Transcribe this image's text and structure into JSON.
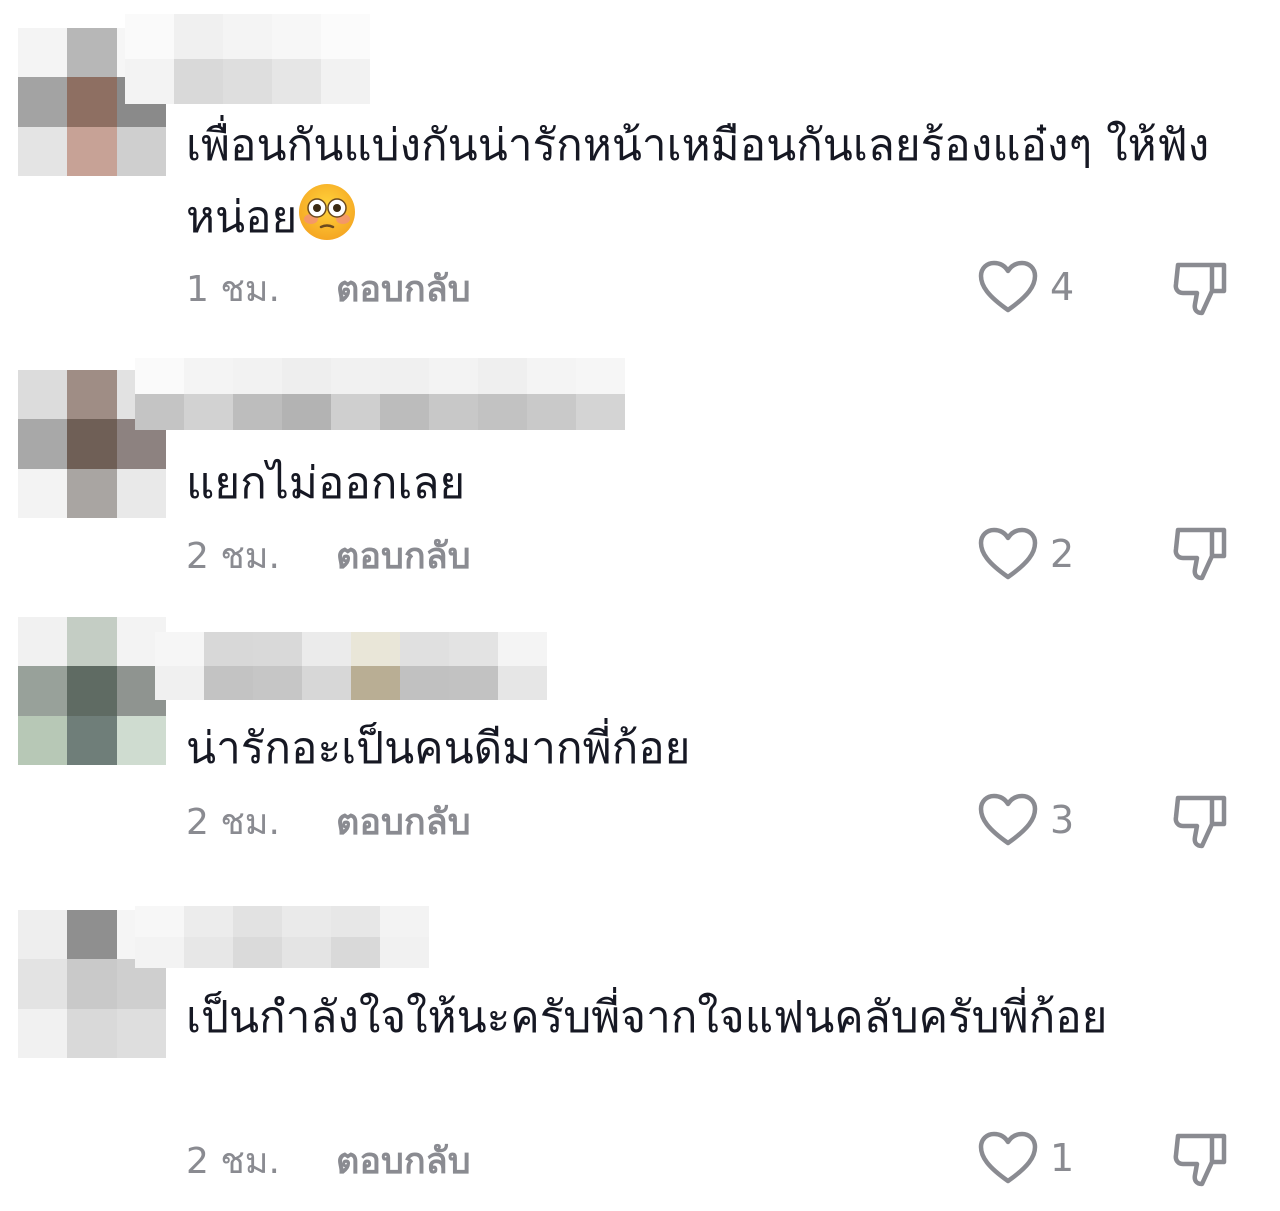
{
  "comments": [
    {
      "text": "เพื่อนกันแบ่งกันน่ารักหน้าเหมือนกันเลยร้องแอ๋งๆ ให้ฟังหน่อย",
      "emoji": "flushed-face",
      "time": "1 ชม.",
      "reply": "ตอบกลับ",
      "likes": "4"
    },
    {
      "text": "แยกไม่ออกเลย",
      "time": "2 ชม.",
      "reply": "ตอบกลับ",
      "likes": "2"
    },
    {
      "text": "น่ารักอะเป็นคนดีมากพี่ก้อย",
      "time": "2 ชม.",
      "reply": "ตอบกลับ",
      "likes": "3"
    },
    {
      "text": "เป็นกำลังใจให้นะครับพี่จากใจแฟนคลับครับพี่ก้อย",
      "time": "2 ชม.",
      "reply": "ตอบกลับ",
      "likes": "1"
    }
  ],
  "icons": {
    "like": "heart-outline-icon",
    "dislike": "thumbs-down-outline-icon"
  },
  "colors": {
    "text": "#161823",
    "meta": "#8a8b91"
  }
}
